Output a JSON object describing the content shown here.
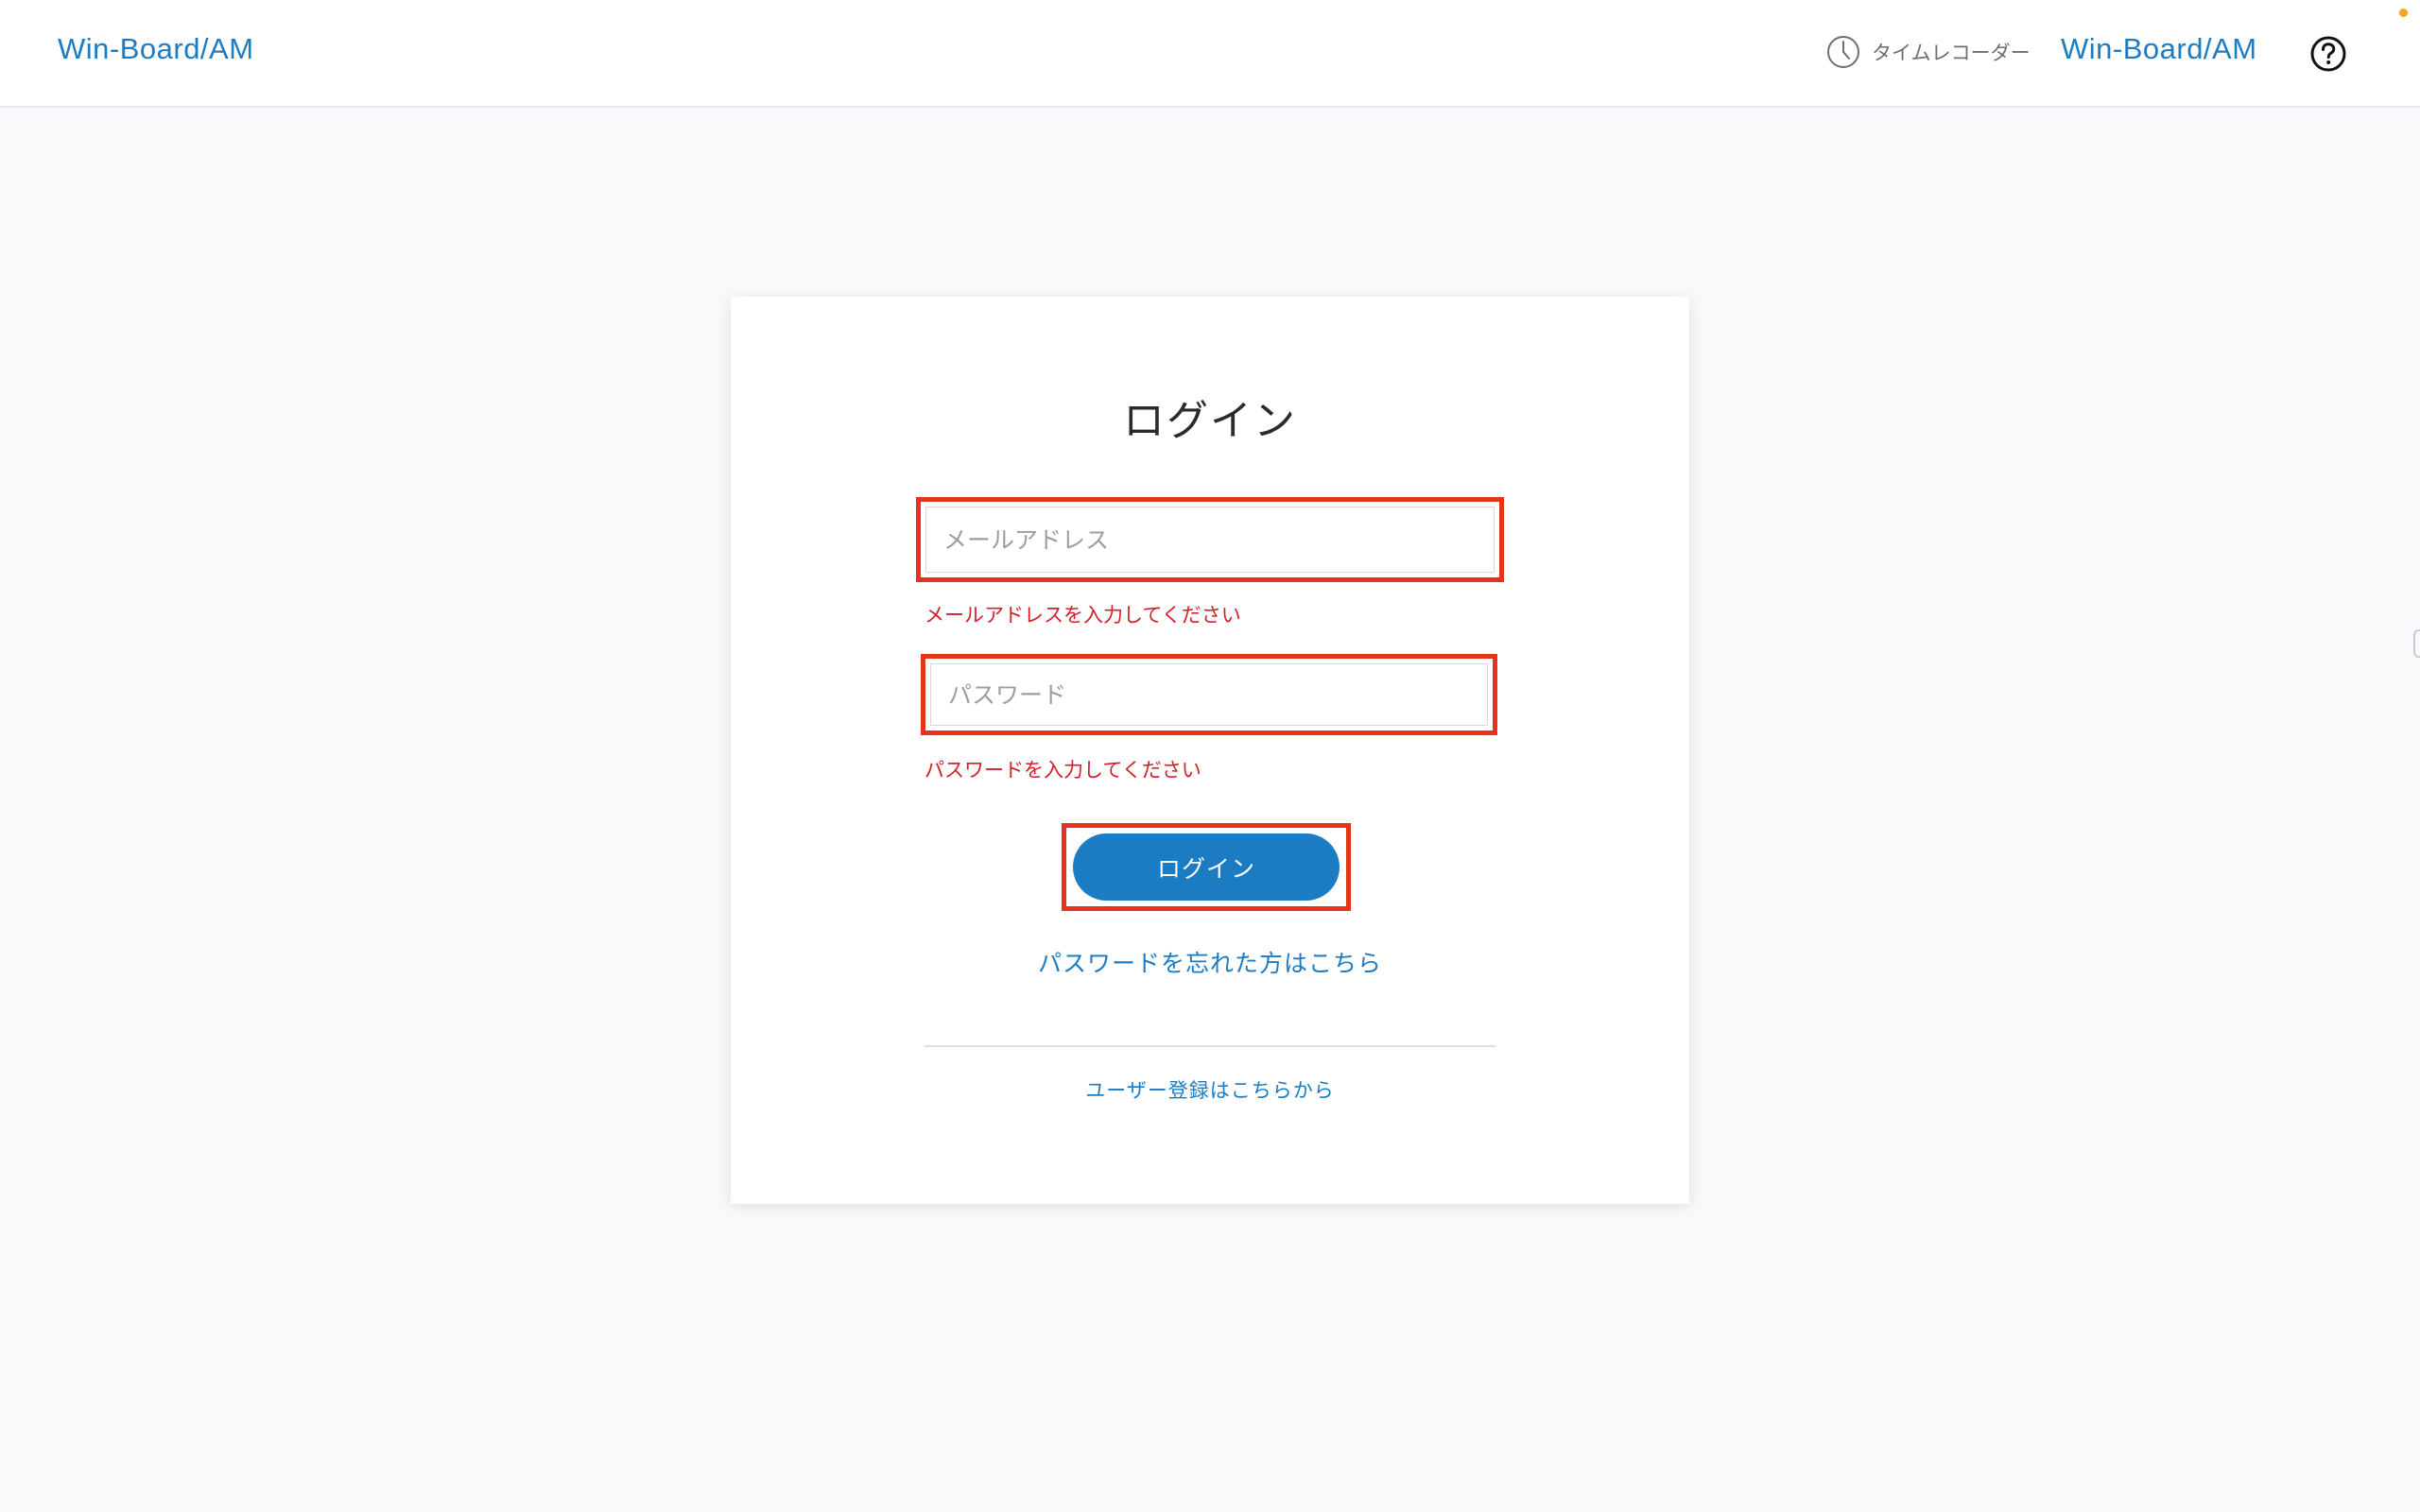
{
  "header": {
    "brand_left": "Win-Board/AM",
    "time_recorder_icon": "clock-icon",
    "time_recorder_label": "タイムレコーダー",
    "brand_right": "Win-Board/AM",
    "help_icon": "question-circle-icon"
  },
  "login_form": {
    "title": "ログイン",
    "email": {
      "placeholder": "メールアドレス",
      "value": "",
      "error": "メールアドレスを入力してください"
    },
    "password": {
      "placeholder": "パスワード",
      "value": "",
      "error": "パスワードを入力してください"
    },
    "login_button_label": "ログイン",
    "forgot_password_link": "パスワードを忘れた方はこちら",
    "register_link": "ユーザー登録はこちらから"
  },
  "colors": {
    "accent": "#1b7cc4",
    "error_text": "#d0202a",
    "highlight_border": "#e8331c",
    "page_background": "#f8f9fb",
    "notification_dot": "#f5a623"
  }
}
